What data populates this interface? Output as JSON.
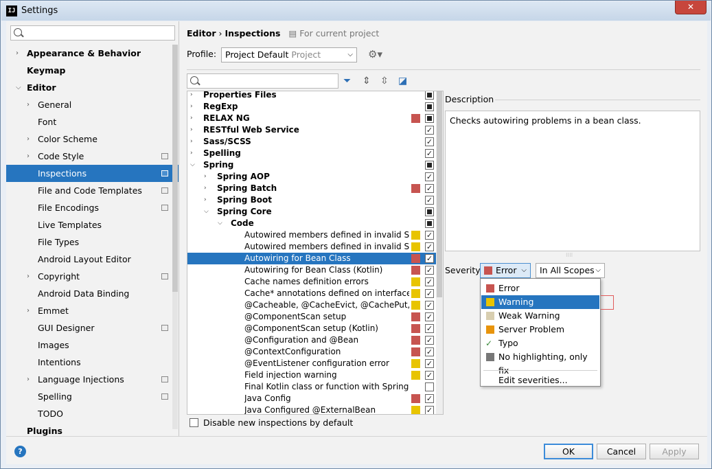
{
  "window": {
    "title": "Settings",
    "app_icon": "IJ"
  },
  "search": {
    "placeholder": ""
  },
  "sidebar": {
    "items": [
      {
        "label": "Appearance & Behavior",
        "level": 0,
        "bold": true,
        "expanded": false,
        "project": false
      },
      {
        "label": "Keymap",
        "level": 0,
        "bold": true,
        "expanded": null,
        "project": false
      },
      {
        "label": "Editor",
        "level": 0,
        "bold": true,
        "expanded": true,
        "project": false
      },
      {
        "label": "General",
        "level": 1,
        "bold": false,
        "expanded": false,
        "project": false
      },
      {
        "label": "Font",
        "level": 1,
        "bold": false,
        "expanded": null,
        "project": false
      },
      {
        "label": "Color Scheme",
        "level": 1,
        "bold": false,
        "expanded": false,
        "project": false
      },
      {
        "label": "Code Style",
        "level": 1,
        "bold": false,
        "expanded": false,
        "project": true
      },
      {
        "label": "Inspections",
        "level": 1,
        "bold": false,
        "expanded": null,
        "project": true,
        "selected": true
      },
      {
        "label": "File and Code Templates",
        "level": 1,
        "bold": false,
        "expanded": null,
        "project": true
      },
      {
        "label": "File Encodings",
        "level": 1,
        "bold": false,
        "expanded": null,
        "project": true
      },
      {
        "label": "Live Templates",
        "level": 1,
        "bold": false,
        "expanded": null,
        "project": false
      },
      {
        "label": "File Types",
        "level": 1,
        "bold": false,
        "expanded": null,
        "project": false
      },
      {
        "label": "Android Layout Editor",
        "level": 1,
        "bold": false,
        "expanded": null,
        "project": false
      },
      {
        "label": "Copyright",
        "level": 1,
        "bold": false,
        "expanded": false,
        "project": true
      },
      {
        "label": "Android Data Binding",
        "level": 1,
        "bold": false,
        "expanded": null,
        "project": false
      },
      {
        "label": "Emmet",
        "level": 1,
        "bold": false,
        "expanded": false,
        "project": false
      },
      {
        "label": "GUI Designer",
        "level": 1,
        "bold": false,
        "expanded": null,
        "project": true
      },
      {
        "label": "Images",
        "level": 1,
        "bold": false,
        "expanded": null,
        "project": false
      },
      {
        "label": "Intentions",
        "level": 1,
        "bold": false,
        "expanded": null,
        "project": false
      },
      {
        "label": "Language Injections",
        "level": 1,
        "bold": false,
        "expanded": false,
        "project": true
      },
      {
        "label": "Spelling",
        "level": 1,
        "bold": false,
        "expanded": null,
        "project": true
      },
      {
        "label": "TODO",
        "level": 1,
        "bold": false,
        "expanded": null,
        "project": false
      },
      {
        "label": "Plugins",
        "level": 0,
        "bold": true,
        "expanded": null,
        "project": false
      }
    ]
  },
  "breadcrumb": {
    "part1": "Editor",
    "sep": "›",
    "part2": "Inspections",
    "scope_note": "For current project"
  },
  "profile": {
    "label": "Profile:",
    "value": "Project Default",
    "value_muted": "Project"
  },
  "inspections": [
    {
      "label": "Properties Files",
      "level": 0,
      "group": true,
      "expanded": false,
      "sev": null,
      "check": "ind"
    },
    {
      "label": "RegExp",
      "level": 0,
      "group": true,
      "expanded": false,
      "sev": null,
      "check": "ind"
    },
    {
      "label": "RELAX NG",
      "level": 0,
      "group": true,
      "expanded": false,
      "sev": "error",
      "check": "ind"
    },
    {
      "label": "RESTful Web Service",
      "level": 0,
      "group": true,
      "expanded": false,
      "sev": null,
      "check": "on"
    },
    {
      "label": "Sass/SCSS",
      "level": 0,
      "group": true,
      "expanded": false,
      "sev": null,
      "check": "on"
    },
    {
      "label": "Spelling",
      "level": 0,
      "group": true,
      "expanded": false,
      "sev": null,
      "check": "on"
    },
    {
      "label": "Spring",
      "level": 0,
      "group": true,
      "expanded": true,
      "sev": null,
      "check": "ind"
    },
    {
      "label": "Spring AOP",
      "level": 1,
      "group": true,
      "expanded": false,
      "sev": null,
      "check": "on"
    },
    {
      "label": "Spring Batch",
      "level": 1,
      "group": true,
      "expanded": false,
      "sev": "error",
      "check": "on"
    },
    {
      "label": "Spring Boot",
      "level": 1,
      "group": true,
      "expanded": false,
      "sev": null,
      "check": "on"
    },
    {
      "label": "Spring Core",
      "level": 1,
      "group": true,
      "expanded": true,
      "sev": null,
      "check": "ind"
    },
    {
      "label": "Code",
      "level": 2,
      "group": true,
      "expanded": true,
      "sev": null,
      "check": "ind"
    },
    {
      "label": "Autowired members defined in invalid Spring bean",
      "level": 3,
      "group": false,
      "sev": "warning",
      "check": "on"
    },
    {
      "label": "Autowired members defined in invalid Spring bean",
      "level": 3,
      "group": false,
      "sev": "warning",
      "check": "on"
    },
    {
      "label": "Autowiring for Bean Class",
      "level": 3,
      "group": false,
      "sev": "error",
      "check": "on",
      "selected": true
    },
    {
      "label": "Autowiring for Bean Class (Kotlin)",
      "level": 3,
      "group": false,
      "sev": "error",
      "check": "on"
    },
    {
      "label": "Cache names definition errors",
      "level": 3,
      "group": false,
      "sev": "warning",
      "check": "on"
    },
    {
      "label": "Cache* annotations defined on interfaces",
      "level": 3,
      "group": false,
      "sev": "warning",
      "check": "on"
    },
    {
      "label": "@Cacheable, @CacheEvict, @CachePut, @CacheConfig",
      "level": 3,
      "group": false,
      "sev": "warning",
      "check": "on"
    },
    {
      "label": "@ComponentScan setup",
      "level": 3,
      "group": false,
      "sev": "error",
      "check": "on"
    },
    {
      "label": "@ComponentScan setup (Kotlin)",
      "level": 3,
      "group": false,
      "sev": "error",
      "check": "on"
    },
    {
      "label": "@Configuration and @Bean",
      "level": 3,
      "group": false,
      "sev": "error",
      "check": "on"
    },
    {
      "label": "@ContextConfiguration",
      "level": 3,
      "group": false,
      "sev": "error",
      "check": "on"
    },
    {
      "label": "@EventListener configuration error",
      "level": 3,
      "group": false,
      "sev": "warning",
      "check": "on"
    },
    {
      "label": "Field injection warning",
      "level": 3,
      "group": false,
      "sev": "warning",
      "check": "on"
    },
    {
      "label": "Final Kotlin class or function with Spring annotation",
      "level": 3,
      "group": false,
      "sev": null,
      "check": "off"
    },
    {
      "label": "Java Config",
      "level": 3,
      "group": false,
      "sev": "error",
      "check": "on"
    },
    {
      "label": "Java Configured @ExternalBean",
      "level": 3,
      "group": false,
      "sev": "warning",
      "check": "on"
    }
  ],
  "description": {
    "label": "Description",
    "text": "Checks autowiring problems in a bean class."
  },
  "severity": {
    "label": "Severity:",
    "value": "Error",
    "scope": "In All Scopes",
    "options": [
      {
        "label": "Error",
        "color": "#c75450"
      },
      {
        "label": "Warning",
        "color": "#e8c400",
        "highlighted": true
      },
      {
        "label": "Weak Warning",
        "color": "#d8ceb0"
      },
      {
        "label": "Server Problem",
        "color": "#e8940c"
      },
      {
        "label": "Typo",
        "color": null
      },
      {
        "label": "No highlighting, only fix",
        "color": "#777777"
      }
    ],
    "edit": "Edit severities..."
  },
  "disable_new": "Disable new inspections by default",
  "buttons": {
    "ok": "OK",
    "cancel": "Cancel",
    "apply": "Apply",
    "help": "?"
  },
  "colors": {
    "error": "#c75450",
    "warning": "#e8c400",
    "selection": "#2675bf"
  }
}
